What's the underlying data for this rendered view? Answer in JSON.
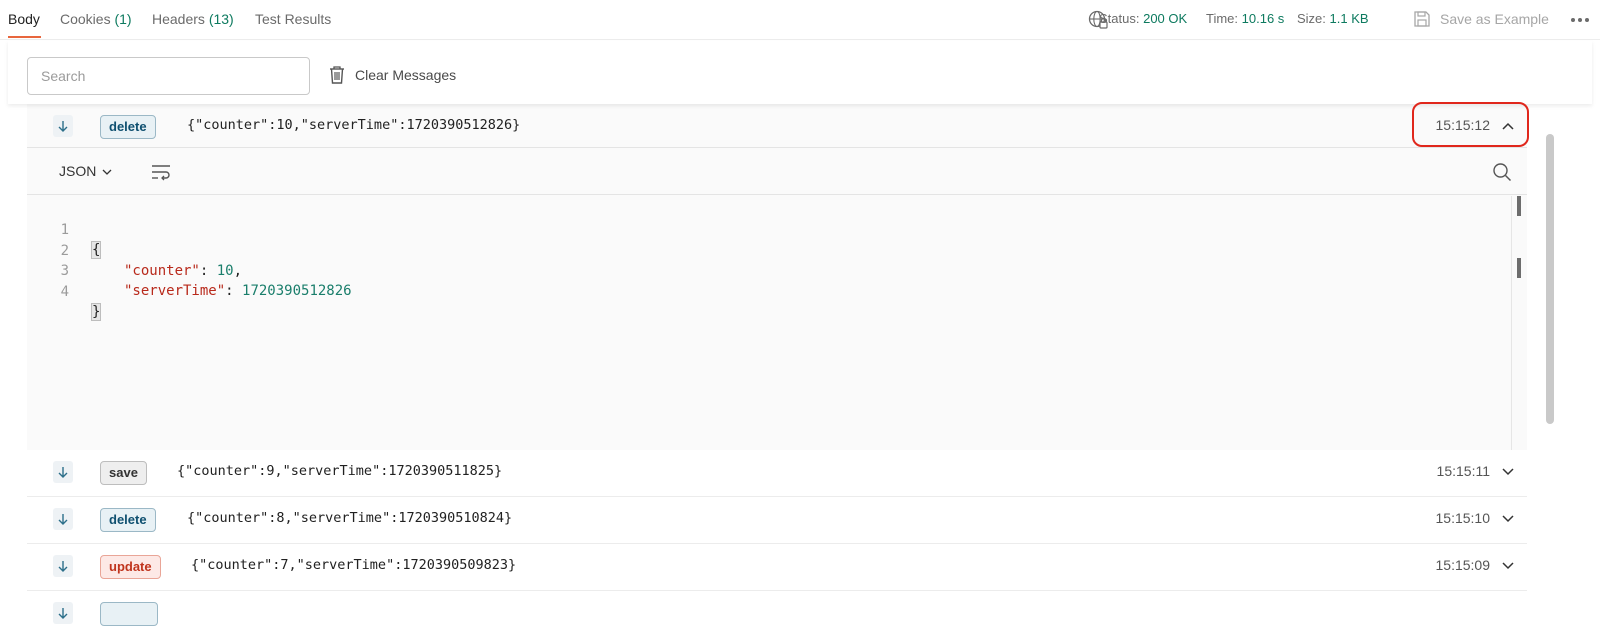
{
  "tabs": [
    {
      "label": "Body",
      "count": ""
    },
    {
      "label": "Cookies",
      "count": "(1)"
    },
    {
      "label": "Headers",
      "count": "(13)"
    },
    {
      "label": "Test Results",
      "count": ""
    }
  ],
  "response_meta": {
    "status_label": "Status:",
    "status_value": "200 OK",
    "time_label": "Time:",
    "time_value": "10.16 s",
    "size_label": "Size:",
    "size_value": "1.1 KB",
    "save_example": "Save as Example"
  },
  "toolbar": {
    "search_placeholder": "Search",
    "clear_label": "Clear Messages"
  },
  "expanded": {
    "format": "JSON",
    "code": {
      "numbers": [
        "1",
        "2",
        "3",
        "4"
      ],
      "open_brace": "{",
      "close_brace": "}",
      "key_counter": "\"counter\"",
      "val_counter": "10",
      "key_serverTime": "\"serverTime\"",
      "val_serverTime": "1720390512826"
    }
  },
  "messages": [
    {
      "event": "delete",
      "type": "delete",
      "payload": "{\"counter\":10,\"serverTime\":1720390512826}",
      "time": "15:15:12",
      "expanded": true
    },
    {
      "event": "save",
      "type": "save",
      "payload": "{\"counter\":9,\"serverTime\":1720390511825}",
      "time": "15:15:11",
      "expanded": false
    },
    {
      "event": "delete",
      "type": "delete",
      "payload": "{\"counter\":8,\"serverTime\":1720390510824}",
      "time": "15:15:10",
      "expanded": false
    },
    {
      "event": "update",
      "type": "update",
      "payload": "{\"counter\":7,\"serverTime\":1720390509823}",
      "time": "15:15:09",
      "expanded": false
    }
  ],
  "colors": {
    "accent": "#e8663d",
    "value_green": "#0d7a5f",
    "highlight_red": "#e0271c"
  }
}
